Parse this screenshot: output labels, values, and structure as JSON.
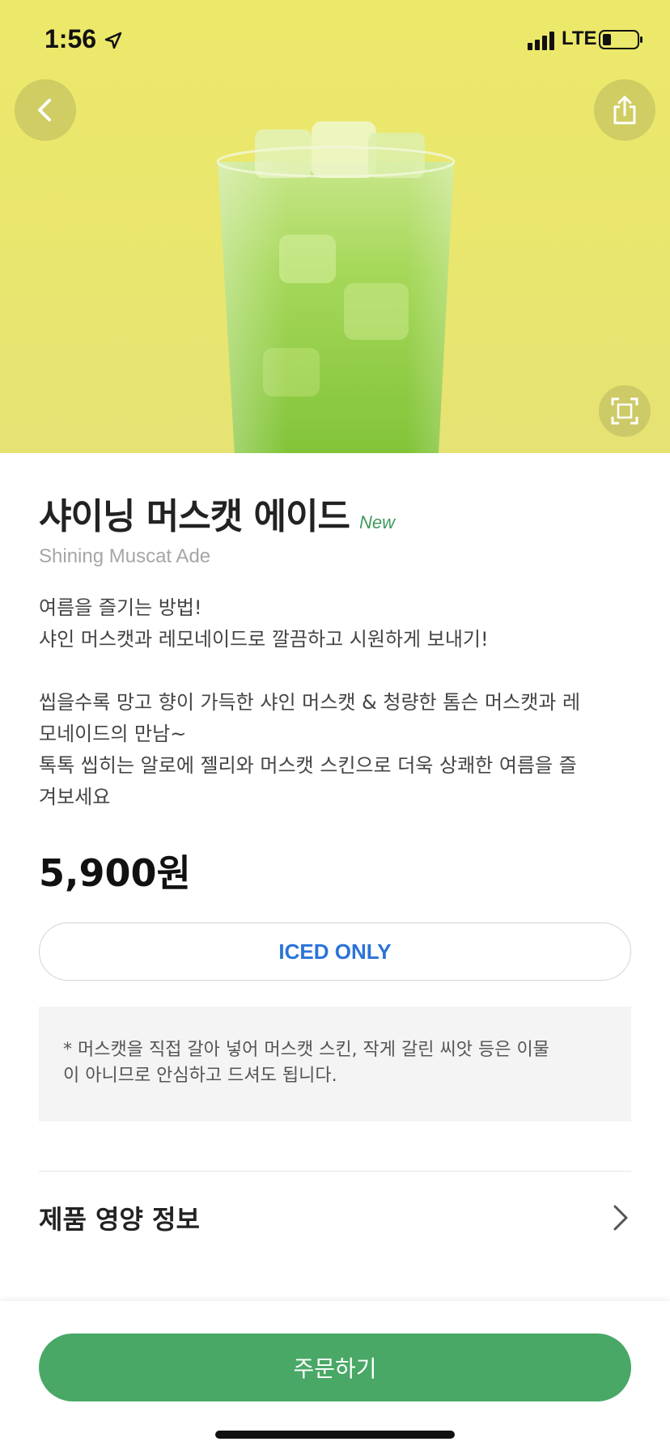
{
  "status_bar": {
    "time": "1:56",
    "network": "LTE"
  },
  "hero": {
    "background_color": "#ece86a",
    "icons": [
      "back-arrow-icon",
      "share-icon",
      "location-arrow-icon",
      "fullscreen-icon"
    ]
  },
  "product": {
    "name": "샤이닝 머스캣 에이드",
    "badge": "New",
    "english_name": "Shining Muscat Ade",
    "description_lines": [
      "여름을 즐기는 방법!",
      "샤인 머스캣과 레모네이드로 깔끔하고 시원하게 보내기!",
      "",
      "씹을수록 망고 향이 가득한 샤인 머스캣 & 청량한 톰슨 머스캣과 레",
      "모네이드의 만남~",
      "톡톡 씹히는 알로에 젤리와 머스캣 스킨으로 더욱 상쾌한 여름을 즐",
      "겨보세요"
    ],
    "price": "5,900원",
    "temperature_option": "ICED ONLY",
    "notice_lines": [
      "* 머스캣을 직접 갈아 넣어 머스캣 스킨, 작게 갈린 씨앗 등은 이물",
      "이 아니므로 안심하고 드셔도 됩니다."
    ],
    "nutrition_label": "제품 영양 정보"
  },
  "footer": {
    "order_button": "주문하기"
  },
  "colors": {
    "accent_green": "#49a866",
    "iced_blue": "#2b73d8",
    "new_badge_green": "#3f9a5e"
  }
}
